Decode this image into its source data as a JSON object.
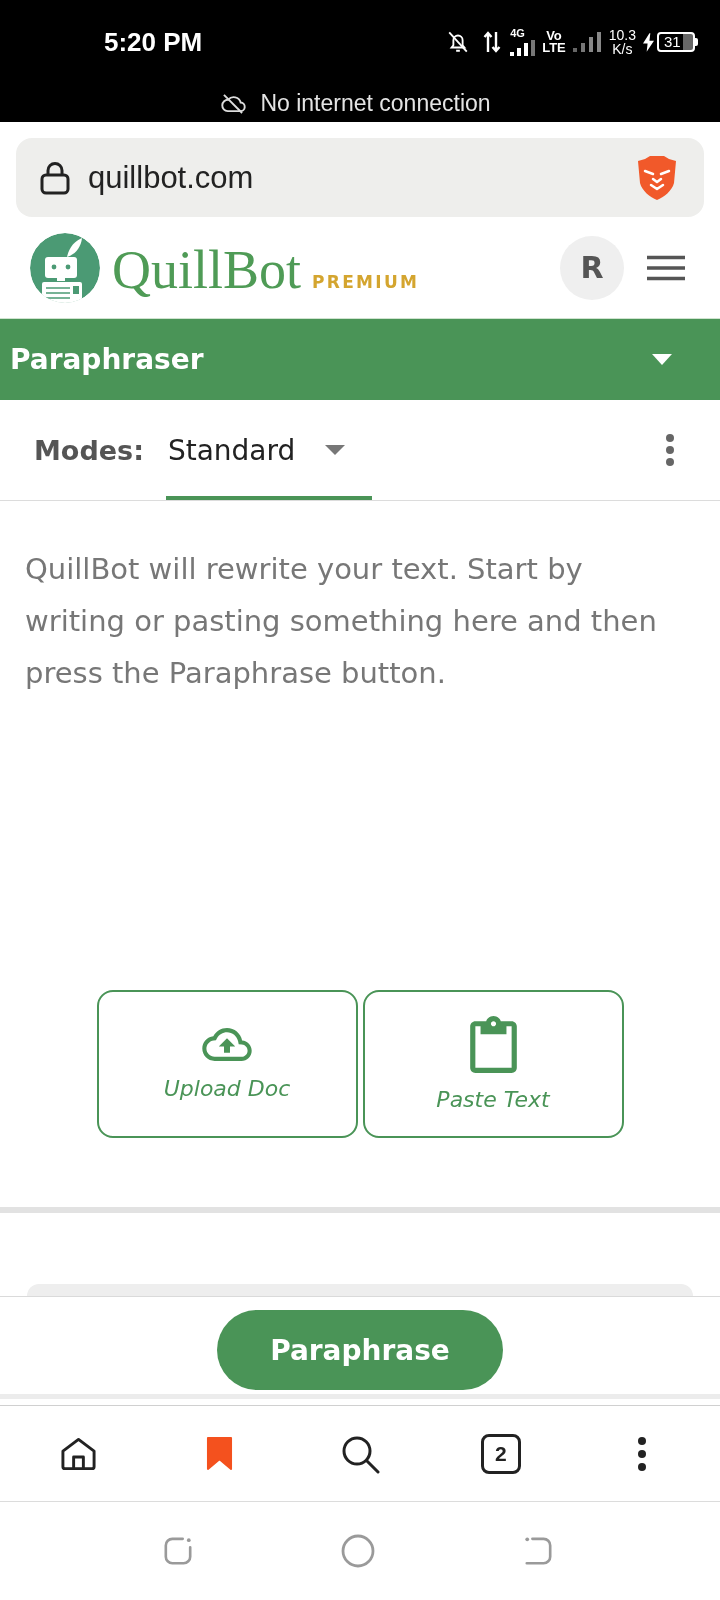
{
  "status_bar": {
    "time": "5:20 PM",
    "network_type": "4G",
    "volte": [
      "Vo",
      "LTE"
    ],
    "speed": [
      "10.3",
      "K/s"
    ],
    "battery": "31",
    "notice": "No internet connection"
  },
  "browser": {
    "url": "quillbot.com"
  },
  "site_header": {
    "brand": "QuillBot",
    "badge": "PREMIUM",
    "avatar": "R"
  },
  "tool_selector": {
    "title": "Paraphraser"
  },
  "modes": {
    "label": "Modes:",
    "tabs": [
      {
        "label": "Standard",
        "selected": true
      }
    ]
  },
  "editor": {
    "placeholder": "QuillBot will rewrite your text. Start by writing or pasting something here and then press the Paraphrase button."
  },
  "actions": [
    {
      "kind": "upload",
      "label": "Upload Doc"
    },
    {
      "kind": "paste",
      "label": "Paste Text"
    }
  ],
  "submit": {
    "label": "Paraphrase"
  },
  "browser_toolbar": {
    "tab_count": "2"
  }
}
